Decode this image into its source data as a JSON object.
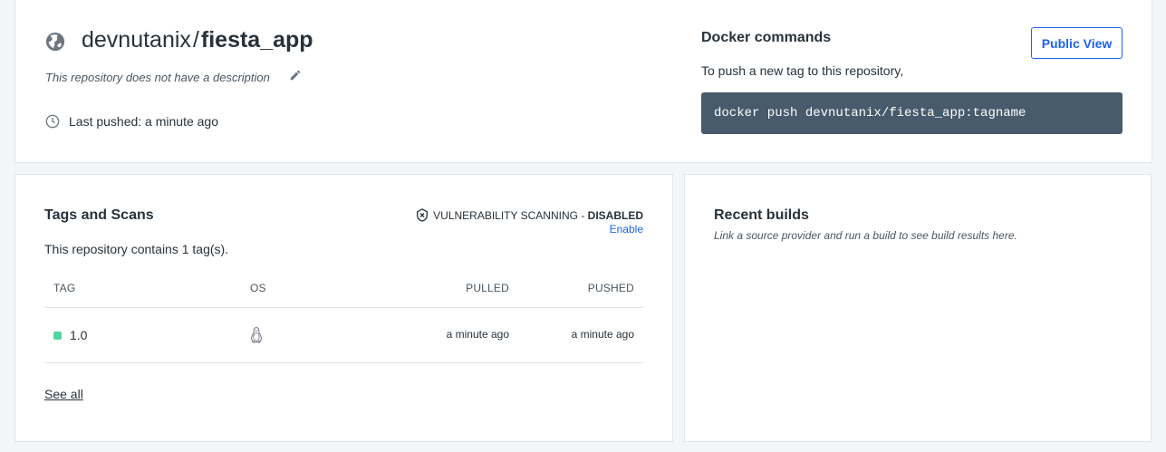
{
  "repo": {
    "namespace": "devnutanix",
    "separator": "/",
    "name": "fiesta_app",
    "description": "This repository does not have a description",
    "last_pushed": "Last pushed: a minute ago"
  },
  "docker": {
    "title": "Docker commands",
    "subtitle": "To push a new tag to this repository,",
    "command": "docker push devnutanix/fiesta_app:tagname",
    "public_view_label": "Public View"
  },
  "tags": {
    "title": "Tags and Scans",
    "count_text": "This repository contains 1 tag(s).",
    "vuln_label": "VULNERABILITY SCANNING",
    "vuln_dash": " - ",
    "vuln_status": "DISABLED",
    "enable_label": "Enable",
    "columns": [
      "TAG",
      "OS",
      "PULLED",
      "PUSHED"
    ],
    "rows": [
      {
        "tag": "1.0",
        "os_icon": "linux-icon",
        "pulled": "a minute ago",
        "pushed": "a minute ago"
      }
    ],
    "see_all_label": "See all"
  },
  "builds": {
    "title": "Recent builds",
    "subtitle": "Link a source provider and run a build to see build results here."
  },
  "colors": {
    "accent": "#1d63ed",
    "command_bg": "#475b6d",
    "tag_status": "#52d3a0",
    "page_bg": "#f4f5f7"
  }
}
